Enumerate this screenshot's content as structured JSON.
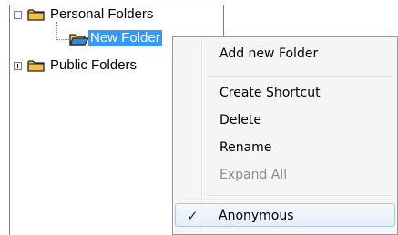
{
  "tree": {
    "items": [
      {
        "label": "Personal Folders",
        "expanded": true
      },
      {
        "label": "New Folder",
        "selected": true
      },
      {
        "label": "Public Folders",
        "expanded": false
      }
    ]
  },
  "context_menu": {
    "items": [
      {
        "label": "Add new Folder"
      },
      {
        "label": "Create Shortcut"
      },
      {
        "label": "Delete"
      },
      {
        "label": "Rename"
      },
      {
        "label": "Expand All",
        "disabled": true
      },
      {
        "label": "Anonymous",
        "checked": true,
        "check_glyph": "✓"
      }
    ]
  },
  "colors": {
    "selection": "#3399ff",
    "folder": "#f5c04a",
    "disabled_text": "#8d8d8d"
  }
}
